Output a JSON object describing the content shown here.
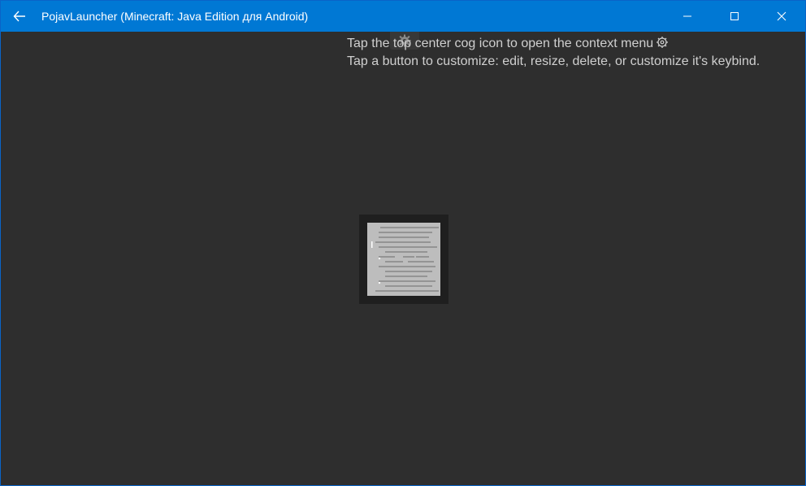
{
  "window": {
    "title": "PojavLauncher (Minecraft: Java Edition для Android)",
    "accent_color": "#0078d4",
    "background_color": "#2e2e2e"
  },
  "titlebar": {
    "back_icon": "arrow-left-icon",
    "minimize_icon": "minimize-icon",
    "maximize_icon": "maximize-icon",
    "close_icon": "close-icon"
  },
  "overlay": {
    "gear_icon": "cog-icon",
    "hint_line_1": "Tap the top center cog icon to open the context menu",
    "hint_line_2": "Tap a button to customize: edit, resize, delete, or customize it's keybind."
  },
  "center_widget": {
    "icon": "document-lines-icon"
  }
}
